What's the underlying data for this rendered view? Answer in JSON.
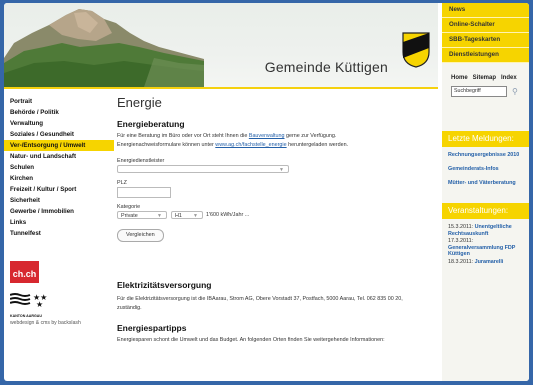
{
  "header": {
    "site_title": "Gemeinde Küttigen",
    "crest_icon": "kuettigen-crest-icon"
  },
  "topnav": [
    "News",
    "Online-Schalter",
    "SBB-Tageskarten",
    "Dienstleistungen"
  ],
  "tools": {
    "links": [
      "Home",
      "Sitemap",
      "Index"
    ],
    "search_placeholder": "Suchbegriff"
  },
  "news_box": {
    "title": "Letzte Meldungen:",
    "items": [
      "Rechnungsergebnisse 2010",
      "Gemeinderats-Infos",
      "Mütter- und Väterberatung"
    ]
  },
  "events_box": {
    "title": "Veranstaltungen:",
    "items": [
      {
        "date": "15.3.2011:",
        "title": "Unentgeltliche Rechtsauskunft"
      },
      {
        "date": "17.3.2011:",
        "title": "Generalversammlung FDP Küttigen"
      },
      {
        "date": "18.3.2011:",
        "title": "Juramarelli"
      }
    ]
  },
  "sidebar": {
    "items": [
      "Portrait",
      "Behörde / Politik",
      "Verwaltung",
      "Soziales / Gesundheit",
      "Ver-/Entsorgung / Umwelt",
      "Natur- und Landschaft",
      "Schulen",
      "Kirchen",
      "Freizeit / Kultur / Sport",
      "Sicherheit",
      "Gewerbe / Immobilien",
      "Links",
      "Tunnelfest"
    ],
    "active_index": 4,
    "chch_label": "ch.ch",
    "kanton_label": "KANTON AARGAU",
    "credit": "webdesign & cms by backslash"
  },
  "main": {
    "title": "Energie",
    "beratung": {
      "heading": "Energieberatung",
      "text_1": "Für eine Beratung im Büro oder vor Ort steht Ihnen die ",
      "link_1": "Bauverwaltung",
      "text_2": " gerne zur Verfügung.",
      "text_3": "Energienachweisformulare können unter ",
      "link_2": "www.ag.ch/fachstelle_energie",
      "text_4": " heruntergeladen werden."
    },
    "form": {
      "provider_label": "Energiedienstleister",
      "provider_value": "",
      "plz_label": "PLZ",
      "plz_value": "",
      "category_label": "Kategorie",
      "category_value": "Private",
      "type_value": "H1",
      "consumption_text": "1'600 kWh/Jahr ...",
      "compare_label": "Vergleichen"
    },
    "versorgung": {
      "heading": "Elektrizitätsversorgung",
      "text": "Für die Elektrizitätsversorgung ist die IBAarau, Strom AG, Obere Vorstadt 37, Postfach, 5000 Aarau, Tel. 062 835 00 20, zuständig."
    },
    "tipps": {
      "heading": "Energiespartipps",
      "text": "Energiesparen schont die Umwelt und das Budget. An folgenden Orten finden Sie weitergehende Informationen:"
    }
  },
  "colors": {
    "accent_yellow": "#f6d400",
    "link_blue": "#2460a8",
    "page_background": "#3566a8",
    "chch_red": "#d7282f"
  }
}
